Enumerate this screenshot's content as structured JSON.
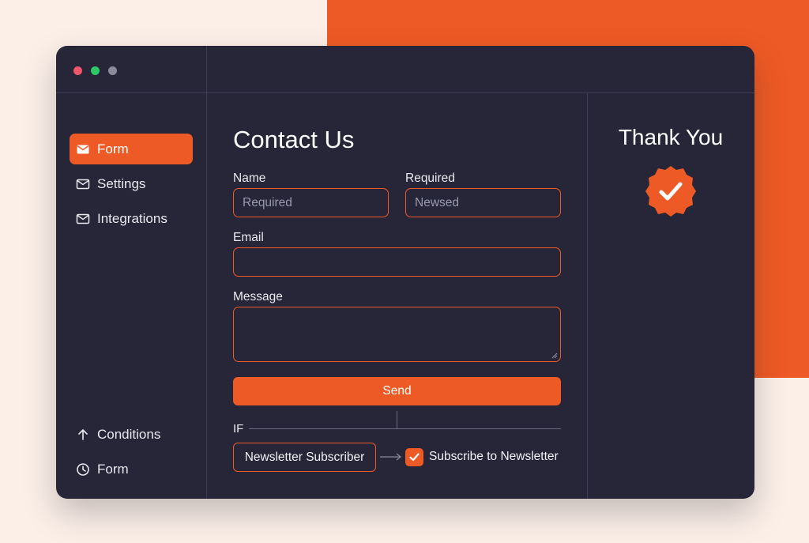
{
  "colors": {
    "accent": "#ee5a25",
    "window_bg": "#262638",
    "page_bg": "#fbefe8"
  },
  "window": {
    "traffic_lights": [
      "#f0576a",
      "#2ec866",
      "#8a8a98"
    ]
  },
  "sidebar": {
    "items": [
      {
        "label": "Form",
        "icon": "envelope-icon",
        "active": true
      },
      {
        "label": "Settings",
        "icon": "envelope-icon",
        "active": false
      },
      {
        "label": "Integrations",
        "icon": "envelope-icon",
        "active": false
      }
    ],
    "bottom_items": [
      {
        "label": "Conditions",
        "icon": "arrow-up-icon"
      },
      {
        "label": "Form",
        "icon": "clock-icon"
      }
    ]
  },
  "form": {
    "title": "Contact Us",
    "name_label": "Name",
    "name_placeholder": "Required",
    "required_label": "Required",
    "required_placeholder": "Newsed",
    "email_label": "Email",
    "email_value": "",
    "message_label": "Message",
    "message_value": "",
    "send_label": "Send"
  },
  "conditions": {
    "if_label": "IF",
    "condition": "Newsletter Subscriber",
    "action_label": "Subscribe to Newsletter",
    "action_checked": true
  },
  "thank_you": {
    "title": "Thank You",
    "icon": "check-badge-icon"
  }
}
